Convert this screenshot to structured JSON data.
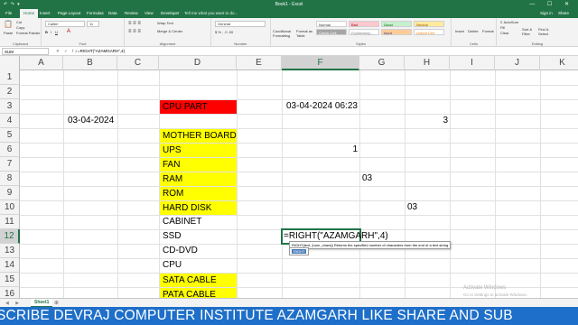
{
  "titlebar": {
    "qat": "↶ ↷ ▾",
    "title": "Book1 - Excel",
    "winbtns": "— ☐ ✕"
  },
  "tabs": {
    "items": [
      "File",
      "Home",
      "Insert",
      "Page Layout",
      "Formulas",
      "Data",
      "Review",
      "View",
      "Developer"
    ],
    "tell_me": "Tell me what you want to do...",
    "sign_in": "Sign in",
    "share": "Share"
  },
  "ribbon": {
    "clipboard": {
      "paste": "Paste",
      "cut": "Cut",
      "copy": "Copy",
      "format_painter": "Format Painter",
      "label": "Clipboard"
    },
    "font": {
      "name": "Calibri",
      "size": "11",
      "label": "Font"
    },
    "alignment": {
      "wrap": "Wrap Text",
      "merge": "Merge & Center",
      "label": "Alignment"
    },
    "number": {
      "format": "General",
      "label": "Number"
    },
    "styles": {
      "conditional": "Conditional Formatting",
      "format_table": "Format as Table",
      "normal": "Normal",
      "bad": "Bad",
      "good": "Good",
      "neutral": "Neutral",
      "check_cell": "Check Cell",
      "explanatory": "Explanatory...",
      "input": "Input",
      "linked_cell": "Linked Cell",
      "note": "Note",
      "label": "Styles"
    },
    "cells": {
      "insert": "Insert",
      "delete": "Delete",
      "format": "Format",
      "label": "Cells"
    },
    "editing": {
      "autosum": "AutoSum",
      "fill": "Fill",
      "clear": "Clear",
      "sort": "Sort & Filter",
      "find": "Find & Select",
      "label": "Editing"
    }
  },
  "formula_bar": {
    "name_box": "SUM",
    "icons": "✕ ✓ fx",
    "formula": "=RIGHT(\"AZAMGARH\",4)"
  },
  "columns": [
    "A",
    "B",
    "C",
    "D",
    "E",
    "F",
    "G",
    "H",
    "I",
    "J",
    "K"
  ],
  "rows": [
    "1",
    "2",
    "3",
    "4",
    "5",
    "6",
    "7",
    "8",
    "9",
    "10",
    "11",
    "12",
    "13",
    "14",
    "15",
    "16"
  ],
  "cells": {
    "d3": "CPU PART",
    "f3": "03-04-2024 06:23",
    "b4": "03-04-2024",
    "h4": "3",
    "d5": "MOTHER BOARD",
    "d6": "UPS",
    "f6": "1",
    "d7": "FAN",
    "d8": "RAM",
    "g8": "03",
    "d9": "ROM",
    "d10": "HARD DISK",
    "h10": "03",
    "d11": "CABINET",
    "d12": "SSD",
    "f12": "=RIGHT(\"AZAMGARH\",4)",
    "d13": "CD-DVD",
    "d14": "CPU",
    "d15": "SATA CABLE",
    "d16": "PATA CABLE"
  },
  "tooltip": "RIGHT(text, [num_chars])   Returns the specified number of characters from the end of a text string",
  "autocomplete": "RIGHT",
  "sheet_tab": "Sheet1",
  "sheet_nav": "◀ ▶",
  "add_sheet": "⊕",
  "watermark": {
    "line1": "Activate Windows",
    "line2": "Go to Settings to activate Windows."
  },
  "banner": "SCRIBE   DEVRAJ COMPUTER INSTITUTE AZAMGARH LIKE SHARE AND SUB",
  "colors": {
    "excel_green": "#217346",
    "red_fill": "#ff0000",
    "yellow_fill": "#ffff00",
    "banner_blue": "#1e6fc9"
  }
}
